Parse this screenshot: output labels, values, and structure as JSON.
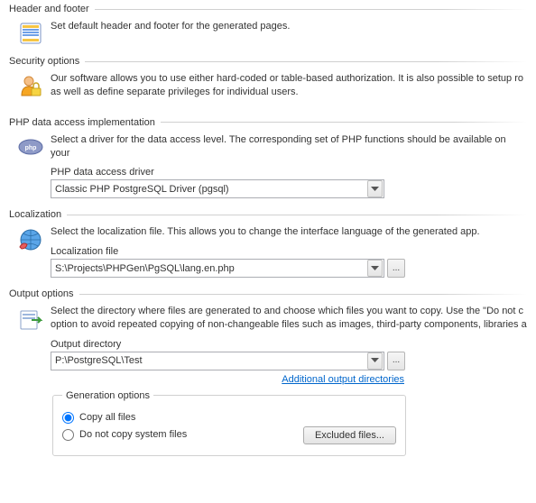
{
  "header_footer": {
    "title": "Header and footer",
    "desc": "Set default header and footer for the generated pages."
  },
  "security": {
    "title": "Security options",
    "desc": "Our software allows you to use either hard-coded or table-based authorization.  It is also possible to setup ro as well as define separate privileges for individual users."
  },
  "php": {
    "title": "PHP data access implementation",
    "desc": "Select a driver for the data access level. The corresponding set of PHP functions should be available on your ",
    "driver_label": "PHP data access driver",
    "driver_value": "Classic PHP PostgreSQL Driver (pgsql)"
  },
  "localization": {
    "title": "Localization",
    "desc": "Select the localization file. This allows you to change the interface language of the generated app.",
    "file_label": "Localization file",
    "file_value": "S:\\Projects\\PHPGen\\PgSQL\\lang.en.php"
  },
  "output": {
    "title": "Output options",
    "desc": "Select the directory where files are generated to and choose which files you want to copy. Use the \"Do not c option to avoid repeated copying of non-changeable files such as images, third-party components, libraries a",
    "dir_label": "Output directory",
    "dir_value": "P:\\PostgreSQL\\Test",
    "additional_link": "Additional output directories",
    "group_title": "Generation options",
    "radio_copy_all": "Copy all files",
    "radio_no_system": "Do not copy system files",
    "excluded_btn": "Excluded files..."
  }
}
